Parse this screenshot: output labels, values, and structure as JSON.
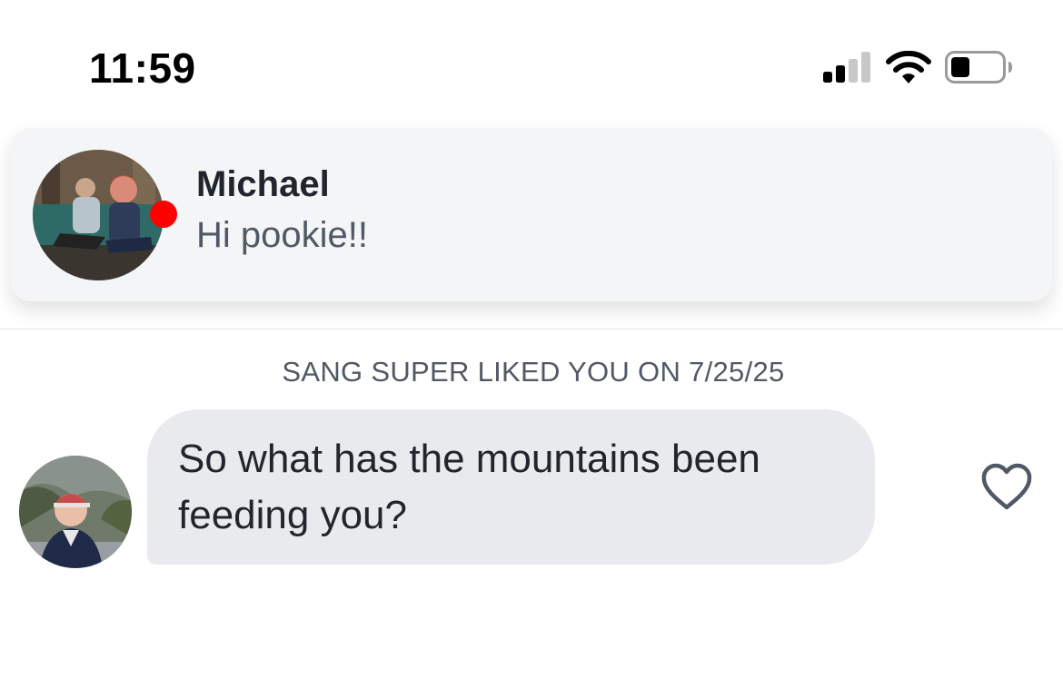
{
  "status_bar": {
    "time": "11:59",
    "icons": [
      "cellular-signal-icon",
      "wifi-icon",
      "battery-icon"
    ]
  },
  "notification": {
    "sender_name": "Michael",
    "preview_text": "Hi pookie!!",
    "online_indicator_color": "#ff0000"
  },
  "chat": {
    "super_like_label": "SANG SUPER LIKED YOU ON 7/25/25",
    "messages": [
      {
        "text": "So what has the mountains been feeding you?",
        "liked": false,
        "icon": "heart-outline-icon"
      }
    ]
  },
  "colors": {
    "banner_bg": "#f4f5f7",
    "bubble_bg": "#e9eaed",
    "primary_text": "#21262e",
    "secondary_text": "#505965"
  }
}
